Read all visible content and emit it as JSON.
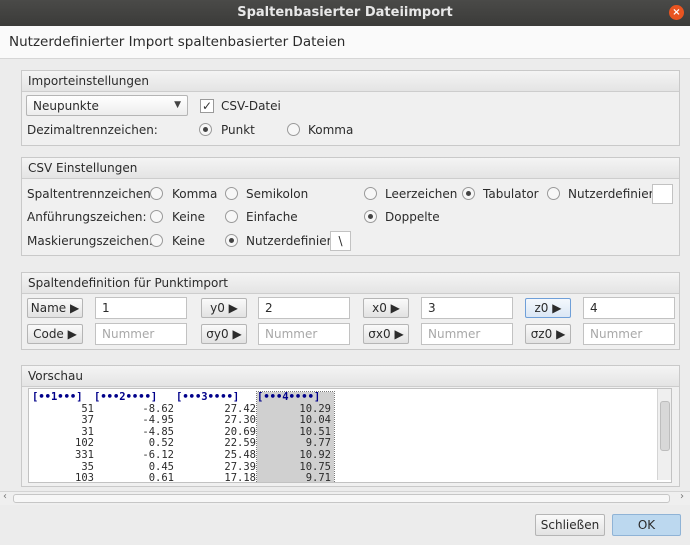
{
  "window": {
    "title": "Spaltenbasierter Dateiimport",
    "close_glyph": "×"
  },
  "header": {
    "title": "Nutzerdefinierter Import spaltenbasierter Dateien"
  },
  "import_settings": {
    "title": "Importeinstellungen",
    "point_type": {
      "selected": "Neupunkte"
    },
    "csv_checkbox": {
      "label": "CSV-Datei",
      "checked": true
    },
    "decimal_label": "Dezimaltrennzeichen:",
    "decimal_options": [
      {
        "label": "Punkt",
        "selected": true
      },
      {
        "label": "Komma",
        "selected": false
      }
    ]
  },
  "csv_settings": {
    "title": "CSV Einstellungen",
    "column_sep": {
      "label": "Spaltentrennzeichen:",
      "options": [
        {
          "label": "Komma",
          "selected": false
        },
        {
          "label": "Semikolon",
          "selected": false
        },
        {
          "label": "Leerzeichen",
          "selected": false
        },
        {
          "label": "Tabulator",
          "selected": true
        },
        {
          "label": "Nutzerdefiniert",
          "selected": false
        }
      ],
      "custom_value": ""
    },
    "quote": {
      "label": "Anführungszeichen:",
      "options": [
        {
          "label": "Keine",
          "selected": false
        },
        {
          "label": "Einfache",
          "selected": false
        },
        {
          "label": "Doppelte",
          "selected": true
        }
      ]
    },
    "escape": {
      "label": "Maskierungszeichen:",
      "options": [
        {
          "label": "Keine",
          "selected": false
        },
        {
          "label": "Nutzerdefiniert",
          "selected": true
        }
      ],
      "custom_value": "\\"
    }
  },
  "column_def": {
    "title": "Spaltendefinition für Punktimport",
    "row1": [
      {
        "button": "Name",
        "value": "1"
      },
      {
        "button": "y0",
        "value": "2"
      },
      {
        "button": "x0",
        "value": "3"
      },
      {
        "button": "z0",
        "value": "4"
      }
    ],
    "row2": [
      {
        "button": "Code",
        "placeholder": "Nummer"
      },
      {
        "button": "σy0",
        "placeholder": "Nummer"
      },
      {
        "button": "σx0",
        "placeholder": "Nummer"
      },
      {
        "button": "σz0",
        "placeholder": "Nummer"
      }
    ],
    "arrow_glyph": "▶"
  },
  "preview": {
    "title": "Vorschau",
    "headers": [
      "[••1•••]",
      "[•••2••••]",
      "[•••3••••]",
      "[•••4••••]"
    ],
    "rows": [
      [
        "51",
        "-8.62",
        "27.42",
        "10.29"
      ],
      [
        "37",
        "-4.95",
        "27.30",
        "10.04"
      ],
      [
        "31",
        "-4.85",
        "20.69",
        "10.51"
      ],
      [
        "102",
        "0.52",
        "22.59",
        "9.77"
      ],
      [
        "331",
        "-6.12",
        "25.48",
        "10.92"
      ],
      [
        "35",
        "0.45",
        "27.39",
        "10.75"
      ],
      [
        "103",
        "0.61",
        "17.18",
        "9.71"
      ]
    ]
  },
  "footer": {
    "close_label": "Schließen",
    "ok_label": "OK"
  },
  "colors": {
    "ok_button": "#bcd8ef",
    "close_badge": "#e95420",
    "header_text": "#00008a",
    "highlight_column": "#d0d0d0"
  }
}
